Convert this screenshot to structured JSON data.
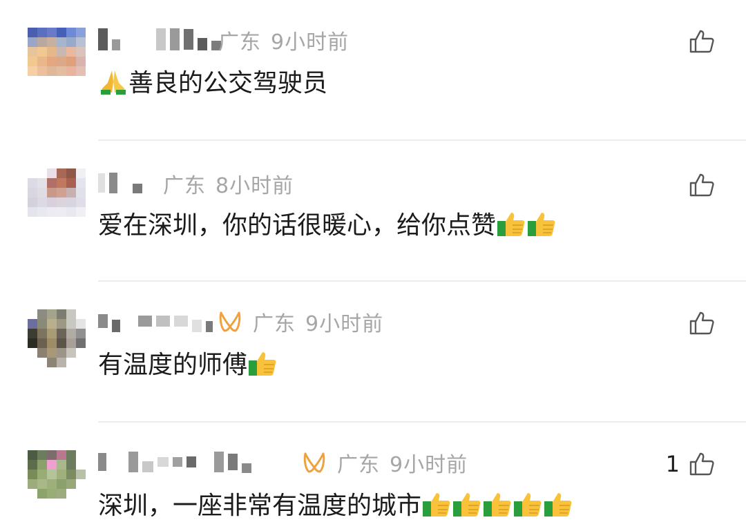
{
  "comments": [
    {
      "location": "广东",
      "time": "9小时前",
      "text": "善良的公交驾驶员",
      "prefix_emoji": "folded-hands-icon",
      "suffix_emojis": 0,
      "likes": "",
      "has_badge": false
    },
    {
      "location": "广东",
      "time": "8小时前",
      "text": "爱在深圳，你的话很暖心，给你点赞",
      "prefix_emoji": "",
      "suffix_emojis": 2,
      "likes": "",
      "has_badge": false
    },
    {
      "location": "广东",
      "time": "9小时前",
      "text": "有温度的师傅",
      "prefix_emoji": "",
      "suffix_emojis": 1,
      "likes": "",
      "has_badge": true
    },
    {
      "location": "广东",
      "time": "9小时前",
      "text": "深圳，一座非常有温度的城市",
      "prefix_emoji": "",
      "suffix_emojis": 5,
      "likes": "1",
      "has_badge": true
    }
  ],
  "colors": {
    "meta": "#a6a6a6",
    "text": "#1b1b1b",
    "badge": "#f0a03c",
    "divider": "#ececec"
  }
}
